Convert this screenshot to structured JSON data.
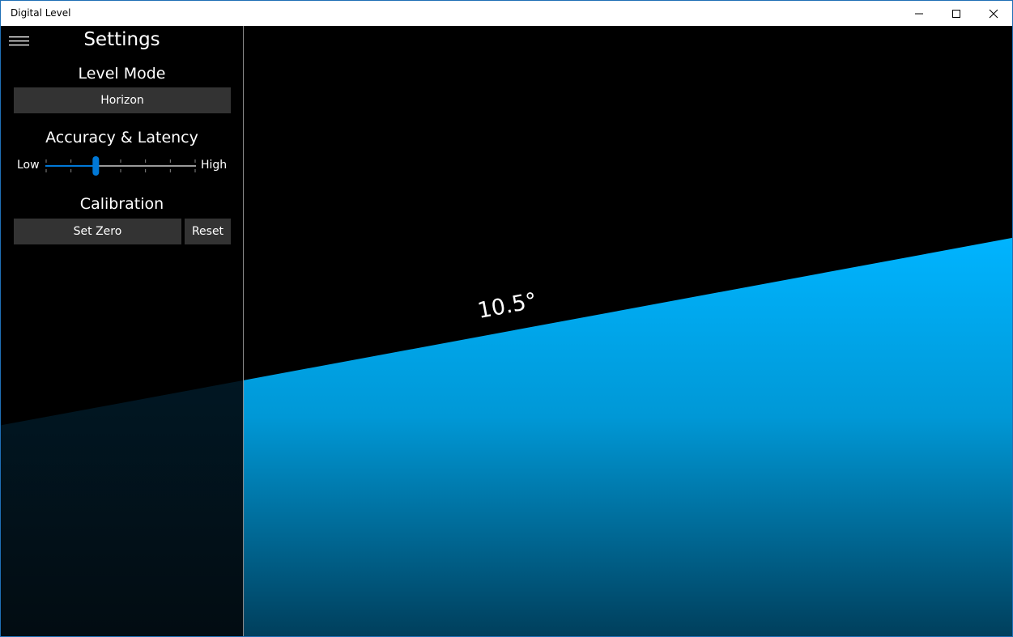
{
  "window": {
    "title": "Digital Level"
  },
  "settings": {
    "title": "Settings",
    "level_mode": {
      "heading": "Level Mode",
      "value": "Horizon"
    },
    "accuracy": {
      "heading": "Accuracy & Latency",
      "low_label": "Low",
      "high_label": "High",
      "ticks": 7,
      "value_index": 2
    },
    "calibration": {
      "heading": "Calibration",
      "set_zero_label": "Set Zero",
      "reset_label": "Reset"
    }
  },
  "level": {
    "angle_deg": 10.5,
    "angle_text": "10.5°"
  },
  "colors": {
    "accent": "#00b4ff",
    "slider_thumb": "#0078d7",
    "button_bg": "#333333"
  },
  "icons": {
    "menu": "hamburger-icon",
    "minimize": "minimize-icon",
    "maximize": "maximize-icon",
    "close": "close-icon"
  }
}
